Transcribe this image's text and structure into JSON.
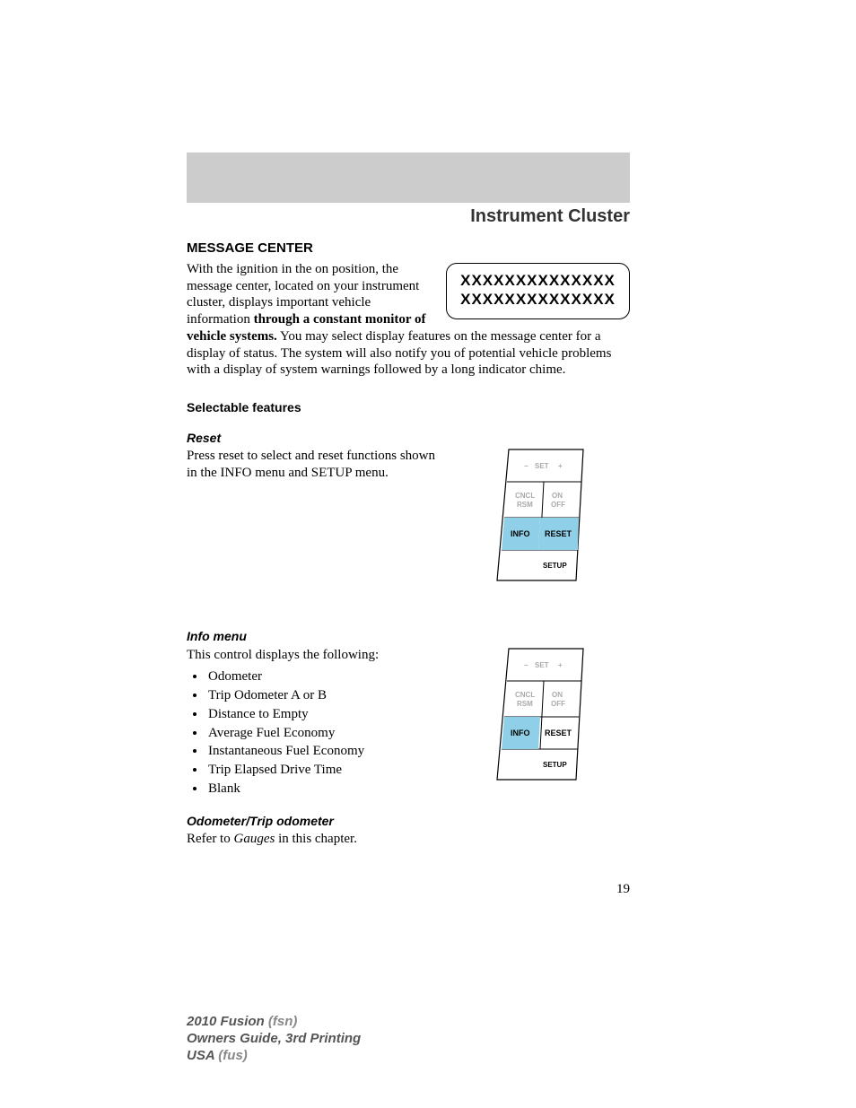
{
  "sectionTitle": "Instrument Cluster",
  "messageCenter": {
    "heading": "MESSAGE CENTER",
    "para1a": "With the ignition in the on position, the message center, located on your instrument cluster, displays important vehicle information ",
    "para1bold": "through a constant monitor of vehicle systems.",
    "para1b": " You may select display features on the message center for a display of status. The system will also notify you of potential vehicle problems with a display of system warnings followed by a long indicator chime.",
    "display": {
      "line1": "XXXXXXXXXXXXXX",
      "line2": "XXXXXXXXXXXXXX"
    }
  },
  "selectable": {
    "heading": "Selectable features"
  },
  "reset": {
    "heading": "Reset",
    "para": "Press reset to select and reset functions shown in the INFO menu and SETUP menu."
  },
  "infoMenu": {
    "heading": "Info menu",
    "intro": "This control displays the following:",
    "items": [
      "Odometer",
      "Trip Odometer A or B",
      "Distance to Empty",
      "Average Fuel Economy",
      "Instantaneous Fuel Economy",
      "Trip Elapsed Drive Time",
      "Blank"
    ]
  },
  "odometer": {
    "heading": "Odometer/Trip odometer",
    "paraA": "Refer to ",
    "paraItalic": "Gauges",
    "paraB": " in this chapter."
  },
  "buttons": {
    "set": "SET",
    "minus": "−",
    "plus": "+",
    "cncl": "CNCL",
    "rsm": "RSM",
    "on": "ON",
    "off": "OFF",
    "info": "INFO",
    "reset": "RESET",
    "setup": "SETUP"
  },
  "pageNumber": "19",
  "footer": {
    "model": "2010 Fusion",
    "modelCode": "(fsn)",
    "guide": "Owners Guide, 3rd Printing",
    "region": "USA",
    "regionCode": "(fus)"
  }
}
